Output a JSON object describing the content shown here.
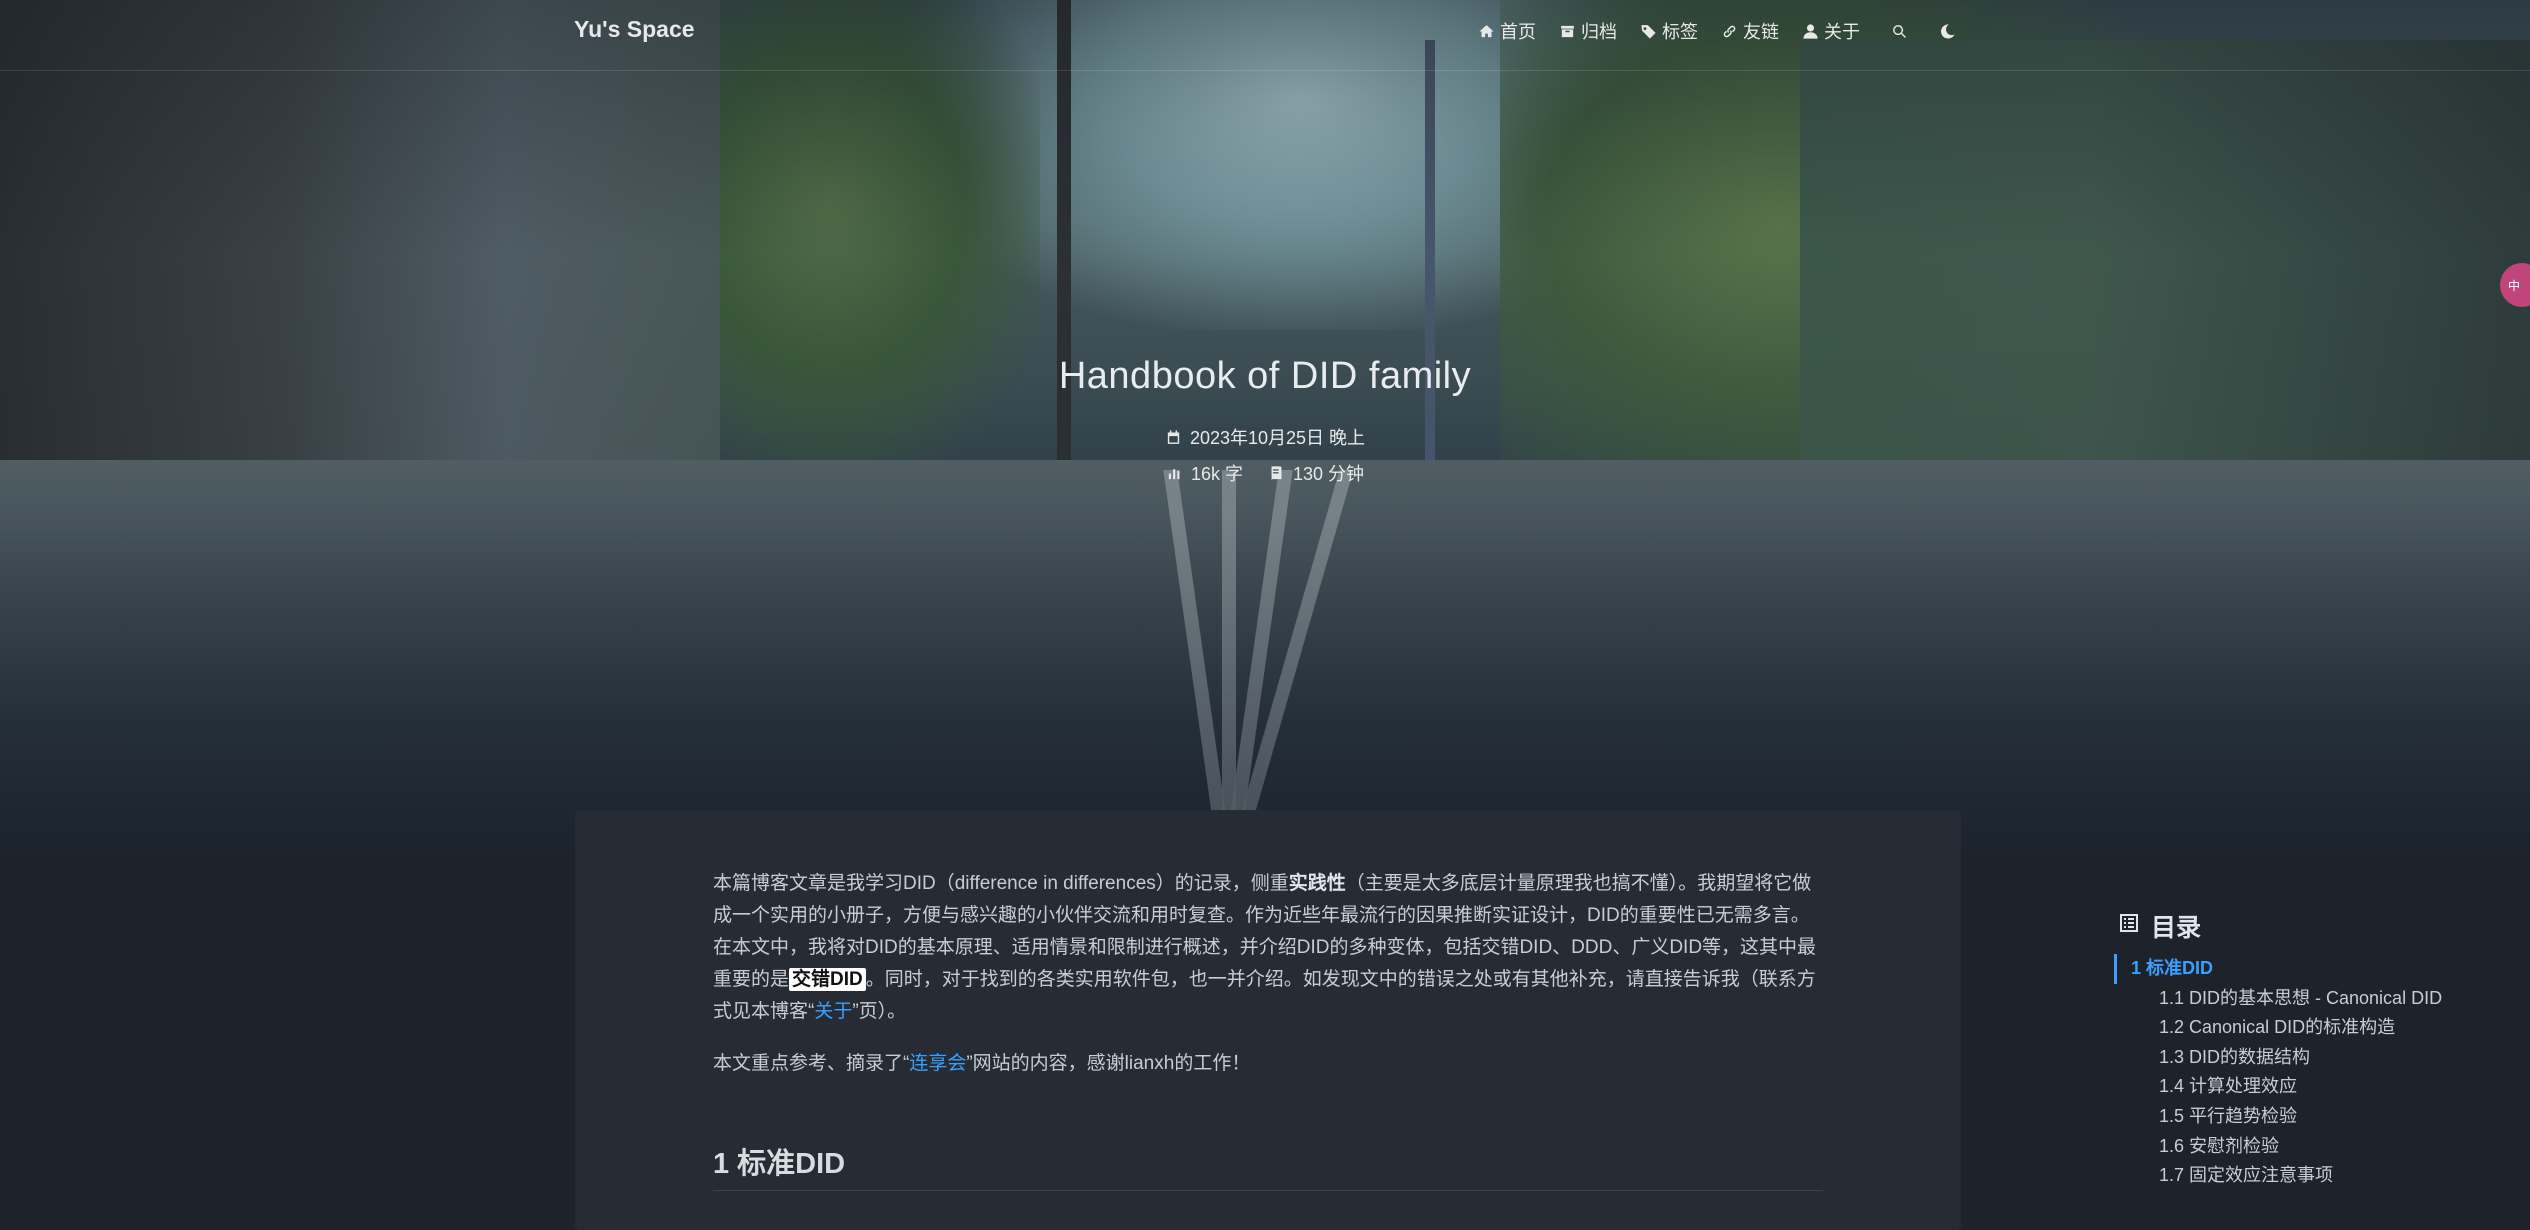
{
  "site": {
    "title": "Yu's Space"
  },
  "nav": {
    "items": [
      {
        "label": "首页",
        "icon": "home-icon"
      },
      {
        "label": "归档",
        "icon": "archive-icon"
      },
      {
        "label": "标签",
        "icon": "tags-icon"
      },
      {
        "label": "友链",
        "icon": "link-icon"
      },
      {
        "label": "关于",
        "icon": "user-icon"
      }
    ],
    "search_icon": "search-icon",
    "theme_icon": "moon-icon"
  },
  "post": {
    "title": "Handbook of DID family",
    "date": "2023年10月25日 晚上",
    "words": "16k 字",
    "read_time": "130 分钟"
  },
  "side_badge": "中",
  "body": {
    "p1_a": "本篇博客文章是我学习DID（difference in differences）的记录，侧重",
    "p1_strong": "实践性",
    "p1_b": "（主要是太多底层计量原理我也搞不懂）。我期望将它做成一个实用的小册子，方便与感兴趣的小伙伴交流和用时复查。作为近些年最流行的因果推断实证设计，DID的重要性已无需多言。在本文中，我将对DID的基本原理、适用情景和限制进行概述，并介绍DID的多种变体，包括交错DID、DDD、广义DID等，这其中最重要的是",
    "p1_highlight": "交错DID",
    "p1_c": "。同时，对于找到的各类实用软件包，也一并介绍。如发现文中的错误之处或有其他补充，请直接告诉我（联系方式见本博客“",
    "p1_link": "关于",
    "p1_d": "”页）。",
    "p2_a": "本文重点参考、摘录了“",
    "p2_link": "连享会",
    "p2_b": "”网站的内容，感谢lianxh的工作！",
    "section_heading": "1 标准DID"
  },
  "toc": {
    "title": "目录",
    "items": [
      {
        "label": "1 标准DID",
        "level": 1,
        "active": true
      },
      {
        "label": "1.1 DID的基本思想 - Canonical DID",
        "level": 2
      },
      {
        "label": "1.2 Canonical DID的标准构造",
        "level": 2
      },
      {
        "label": "1.3 DID的数据结构",
        "level": 2
      },
      {
        "label": "1.4 计算处理效应",
        "level": 2
      },
      {
        "label": "1.5 平行趋势检验",
        "level": 2
      },
      {
        "label": "1.6 安慰剂检验",
        "level": 2
      },
      {
        "label": "1.7 固定效应注意事项",
        "level": 2
      }
    ]
  },
  "colors": {
    "accent": "#3aa0ff",
    "card_bg": "#262b34",
    "page_bg": "#1e222a"
  }
}
